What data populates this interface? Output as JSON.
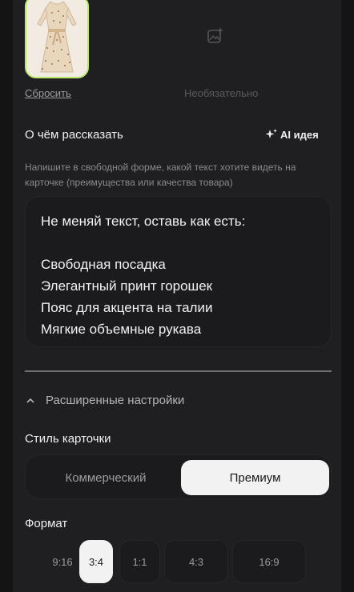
{
  "upload": {
    "reset_label": "Сбросить",
    "optional_label": "Необязательно"
  },
  "description": {
    "title": "О чём рассказать",
    "ai_label": "AI идея",
    "hint": "Напишите в свободной форме, какой текст хотите видеть на карточке (преимущества или качества товара)",
    "text": "Не меняй текст, оставь как есть:\n\nСвободная посадка\nЭлегантный принт горошек\nПояс для акцента на талии\nМягкие объемные рукава"
  },
  "advanced": {
    "toggle_label": "Расширенные настройки"
  },
  "card_style": {
    "label": "Стиль карточки",
    "options": [
      "Коммерческий",
      "Премиум"
    ],
    "selected": "Премиум"
  },
  "format": {
    "label": "Формат",
    "options": [
      "9:16",
      "3:4",
      "1:1",
      "4:3",
      "16:9"
    ],
    "selected": "3:4"
  },
  "colors": {
    "accent_border": "#b8e86a",
    "background": "#1f1f21",
    "selected_bg": "#f2f2f3"
  }
}
